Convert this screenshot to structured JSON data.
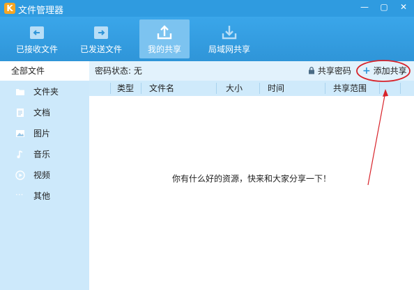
{
  "window": {
    "title": "文件管理器",
    "min_glyph": "—",
    "max_glyph": "▢",
    "close_glyph": "✕",
    "logo_glyph": "K"
  },
  "toolbar": {
    "received": "已接收文件",
    "sent": "已发送文件",
    "my_share": "我的共享",
    "lan_share": "局域网共享"
  },
  "sidebar": {
    "all": "全部文件",
    "folders": "文件夹",
    "docs": "文档",
    "images": "图片",
    "music": "音乐",
    "video": "视频",
    "other": "其他",
    "other_glyph": "···"
  },
  "status": {
    "password_status": "密码状态: 无",
    "share_password": "共享密码",
    "add_share": "添加共享",
    "add_glyph": "+"
  },
  "table": {
    "col_type": "类型",
    "col_name": "文件名",
    "col_size": "大小",
    "col_time": "时间",
    "col_scope": "共享范围"
  },
  "empty_message": "你有什么好的资源，快来和大家分享一下！",
  "colors": {
    "titlebar": "#2f9be0",
    "sidebar": "#cde9fb",
    "annotation": "#d8232a"
  }
}
